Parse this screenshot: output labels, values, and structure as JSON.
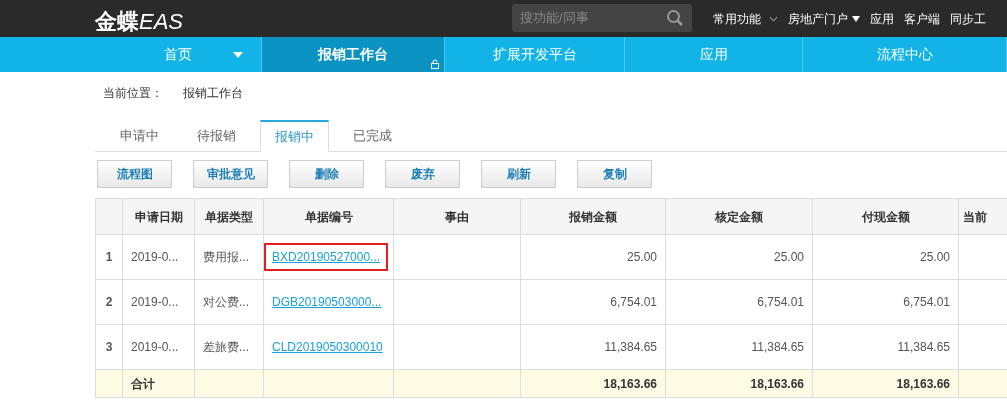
{
  "header": {
    "logo_bold": "金蝶",
    "logo_light": "EAS",
    "search": {
      "placeholder": "搜功能/同事"
    },
    "menus": [
      {
        "label": "常用功能",
        "kind": "dropdown"
      },
      {
        "label": "房地产门户",
        "kind": "menu"
      },
      {
        "label": "应用",
        "kind": "link"
      },
      {
        "label": "客户端",
        "kind": "link"
      },
      {
        "label": "同步工",
        "kind": "link"
      }
    ]
  },
  "nav": [
    {
      "label": "首页",
      "selected": false,
      "dropdown": true,
      "locked": false
    },
    {
      "label": "报销工作台",
      "selected": true,
      "dropdown": false,
      "locked": true
    },
    {
      "label": "扩展开发平台",
      "selected": false,
      "dropdown": false,
      "locked": false
    },
    {
      "label": "应用",
      "selected": false,
      "dropdown": false,
      "locked": false
    },
    {
      "label": "流程中心",
      "selected": false,
      "dropdown": false,
      "locked": false
    }
  ],
  "breadcrumb": {
    "label": "当前位置：",
    "value": "报销工作台"
  },
  "tabs": [
    {
      "label": "申请中",
      "selected": false
    },
    {
      "label": "待报销",
      "selected": false
    },
    {
      "label": "报销中",
      "selected": true
    },
    {
      "label": "已完成",
      "selected": false
    }
  ],
  "buttons": [
    "流程图",
    "审批意见",
    "删除",
    "废弃",
    "刷新",
    "复制"
  ],
  "table": {
    "columns": [
      "申请日期",
      "单据类型",
      "单据编号",
      "事由",
      "报销金额",
      "核定金额",
      "付现金额",
      "当前"
    ],
    "rows": [
      {
        "index": "1",
        "date": "2019-0...",
        "type": "费用报...",
        "number": "BXD20190527000...",
        "amounts": [
          "25.00",
          "25.00",
          "25.00"
        ],
        "highlighted": true
      },
      {
        "index": "2",
        "date": "2019-0...",
        "type": "对公费...",
        "number": "DGB20190503000...",
        "amounts": [
          "6,754.01",
          "6,754.01",
          "6,754.01"
        ],
        "highlighted": false
      },
      {
        "index": "3",
        "date": "2019-0...",
        "type": "差旅费...",
        "number": "CLD2019050300010",
        "amounts": [
          "11,384.65",
          "11,384.65",
          "11,384.65"
        ],
        "highlighted": false
      }
    ],
    "total": {
      "label": "合计",
      "amounts": [
        "18,163.66",
        "18,163.66",
        "18,163.66"
      ]
    }
  }
}
